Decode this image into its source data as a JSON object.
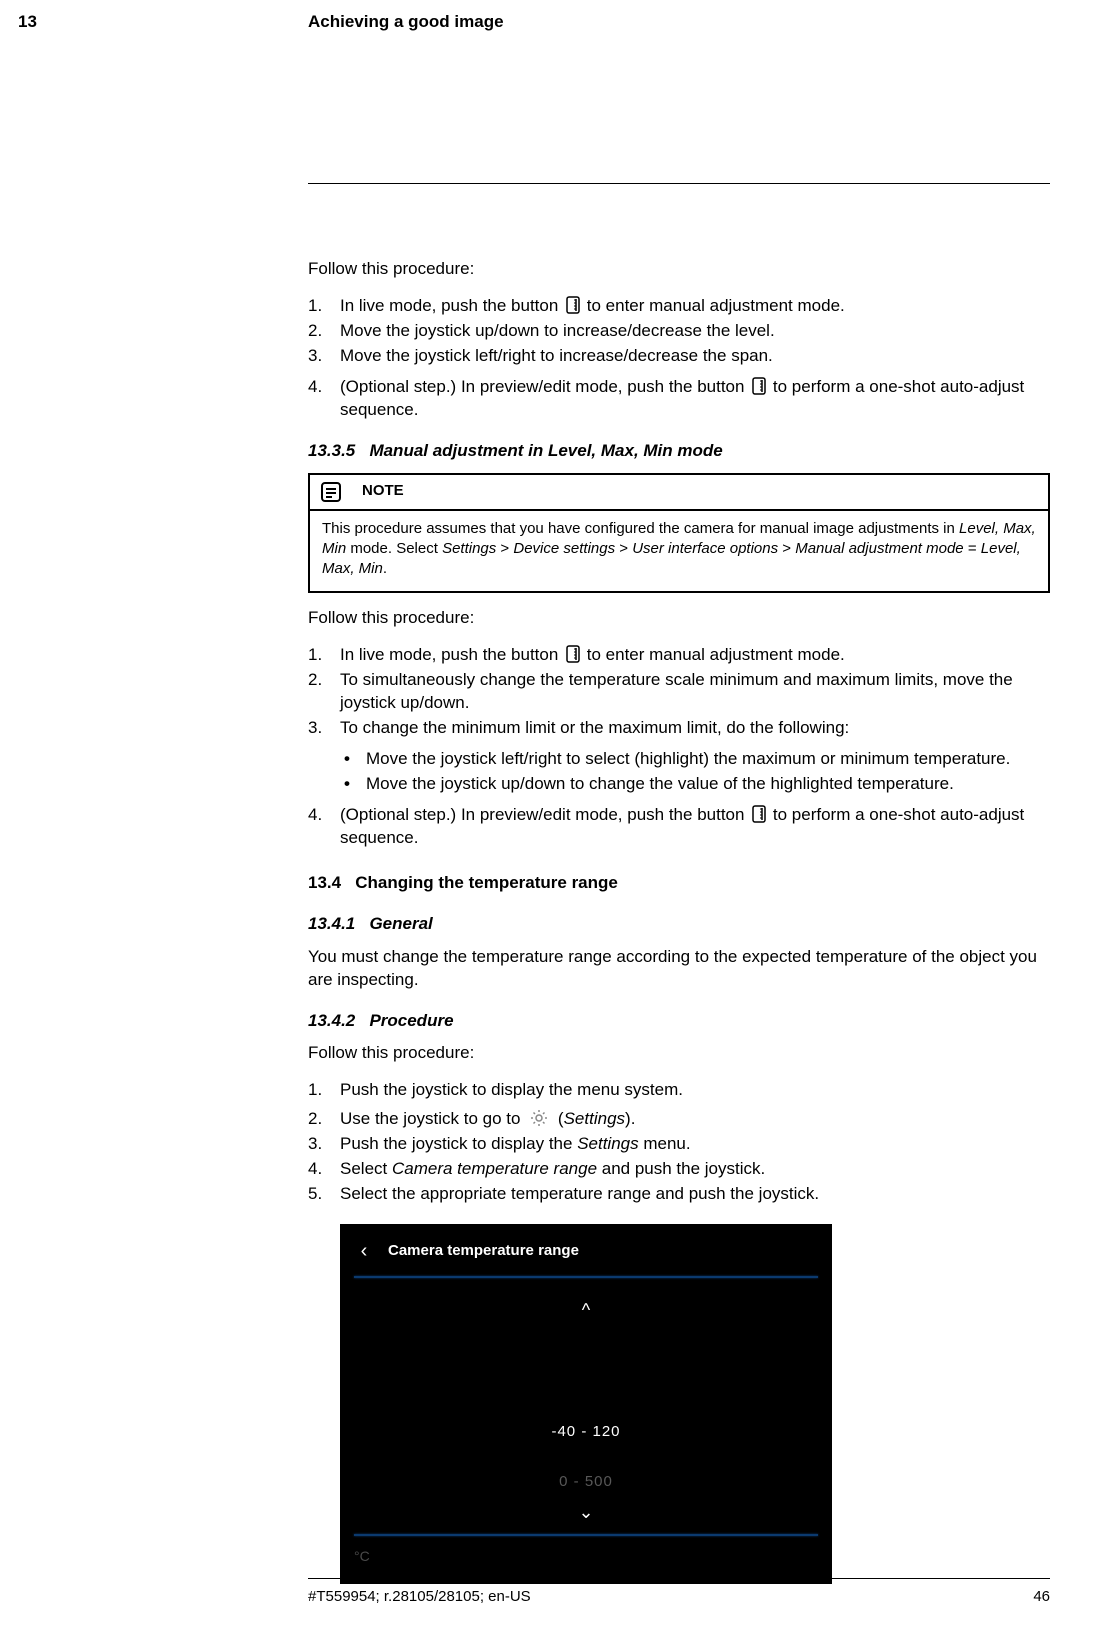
{
  "header": {
    "chapter_num": "13",
    "chapter_title": "Achieving a good image"
  },
  "sec1": {
    "intro": "Follow this procedure:",
    "steps": {
      "s1a": "In live mode, push the button ",
      "s1b": " to enter manual adjustment mode.",
      "s2": "Move the joystick up/down to increase/decrease the level.",
      "s3": "Move the joystick left/right to increase/decrease the span.",
      "s4a": "(Optional step.) In preview/edit mode, push the button ",
      "s4b": " to perform a one-shot auto-adjust sequence."
    }
  },
  "sub1335": {
    "num": "13.3.5",
    "title": "Manual adjustment in Level, Max, Min mode",
    "note_label": "NOTE",
    "note_a": "This procedure assumes that you have configured the camera for manual image adjustments in ",
    "note_i1": "Level, Max, Min",
    "note_b": " mode. Select ",
    "note_i2": "Settings",
    "note_c": " > ",
    "note_i3": "Device settings",
    "note_d": " > ",
    "note_i4": "User interface options",
    "note_e": " > ",
    "note_i5": "Manual adjustment mode",
    "note_f": " = ",
    "note_i6": "Level, Max, Min",
    "note_g": ".",
    "intro": "Follow this procedure:",
    "steps": {
      "s1a": "In live mode, push the button ",
      "s1b": " to enter manual adjustment mode.",
      "s2": "To simultaneously change the temperature scale minimum and maximum limits, move the joystick up/down.",
      "s3": "To change the minimum limit or the maximum limit, do the following:",
      "b1": "Move the joystick left/right to select (highlight) the maximum or minimum temperature.",
      "b2": "Move the joystick up/down to change the value of the highlighted temperature.",
      "s4a": "(Optional step.) In preview/edit mode, push the button ",
      "s4b": " to perform a one-shot auto-adjust sequence."
    }
  },
  "sec134": {
    "num": "13.4",
    "title": "Changing the temperature range",
    "sub1": {
      "num": "13.4.1",
      "title": "General",
      "body": "You must change the temperature range according to the expected temperature of the object you are inspecting."
    },
    "sub2": {
      "num": "13.4.2",
      "title": "Procedure",
      "intro": "Follow this procedure:",
      "s1": "Push the joystick to display the menu system.",
      "s2a": "Use the joystick to go to ",
      "s2b": " (",
      "s2c": "Settings",
      "s2d": ").",
      "s3a": "Push the joystick to display the ",
      "s3b": "Settings",
      "s3c": " menu.",
      "s4a": "Select ",
      "s4b": "Camera temperature range",
      "s4c": " and push the joystick.",
      "s5": "Select the appropriate temperature range and push the joystick."
    }
  },
  "screenshot": {
    "title": "Camera temperature range",
    "opt1": "-40 - 120",
    "opt2": "0 - 500",
    "unit": "°C"
  },
  "footer": {
    "left": "#T559954; r.28105/28105; en-US",
    "right": "46"
  }
}
